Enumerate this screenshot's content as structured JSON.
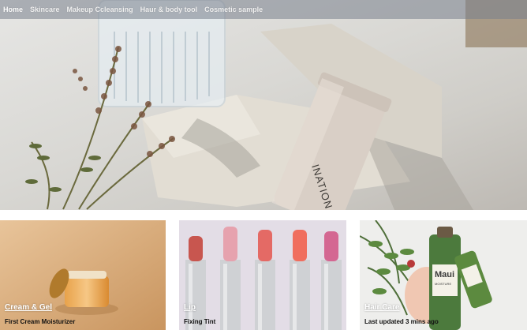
{
  "nav": {
    "items": [
      {
        "label": "Home",
        "active": true
      },
      {
        "label": "Skincare"
      },
      {
        "label": "Makeup Ccleansing"
      },
      {
        "label": "Haur & body tool"
      },
      {
        "label": "Cosmetic sample"
      }
    ]
  },
  "hero": {
    "product_text": "INATION MASK"
  },
  "cards": [
    {
      "category": "Cream & Gel",
      "subtitle": "First Cream Moisturizer"
    },
    {
      "category": "Lip",
      "subtitle": "Fixing Tint"
    },
    {
      "category": "Hair Care",
      "subtitle": "Last updated 3 mins ago",
      "bottle_brand": "Maui",
      "bottle_label": "MOISTURE"
    }
  ],
  "colors": {
    "nav_bg": "#78808c",
    "accent_text": "#ffffff"
  }
}
